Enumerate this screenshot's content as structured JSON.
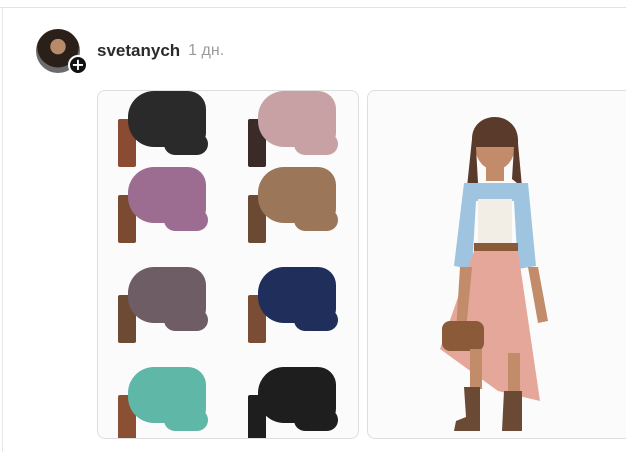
{
  "post": {
    "author": "svetanych",
    "time": "1 дн.",
    "avatar_action_symbol": "+"
  },
  "images": [
    {
      "name": "shoes-collage",
      "shoes": [
        {
          "boot": "#2a2a2a",
          "heel": "#8b4b32"
        },
        {
          "boot": "#c7a1a3",
          "heel": "#3a2a28"
        },
        {
          "boot": "#9c6d91",
          "heel": "#7c4a30"
        },
        {
          "boot": "#9b7658",
          "heel": "#6b4a34"
        },
        {
          "boot": "#6f5d66",
          "heel": "#6d4a33"
        },
        {
          "boot": "#1f2e5a",
          "heel": "#7a4d34"
        },
        {
          "boot": "#5fb7a8",
          "heel": "#8b4f34"
        },
        {
          "boot": "#1e1e1e",
          "heel": "#1e1e1e"
        }
      ]
    },
    {
      "name": "outfit-photo",
      "colors": {
        "jacket": "#9ec4df",
        "skirt": "#e6a79b",
        "bag": "#8a5a39",
        "boots": "#6a4a34",
        "skin": "#c28c6b",
        "hair": "#5a3a2a"
      }
    }
  ]
}
